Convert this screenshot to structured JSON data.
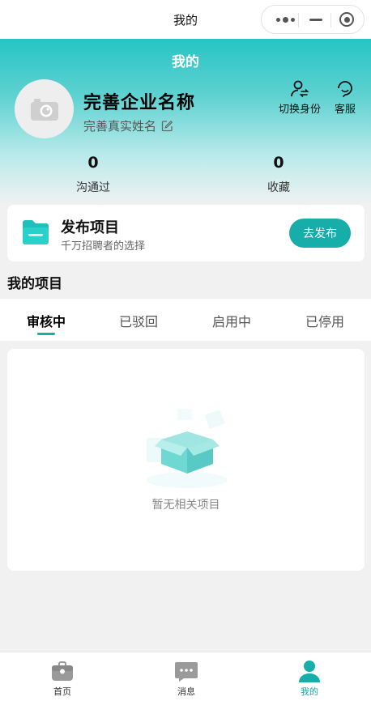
{
  "nav": {
    "title": "我的"
  },
  "header": {
    "title": "我的",
    "company_name": "完善企业名称",
    "real_name": "完善真实姓名",
    "actions": [
      {
        "label": "切换身份",
        "icon": "switch-user-icon"
      },
      {
        "label": "客服",
        "icon": "customer-service-icon"
      }
    ],
    "stats": [
      {
        "value": "0",
        "label": "沟通过"
      },
      {
        "value": "0",
        "label": "收藏"
      }
    ]
  },
  "publish": {
    "title": "发布项目",
    "subtitle": "千万招聘者的选择",
    "button": "去发布"
  },
  "projects": {
    "section_title": "我的项目",
    "tabs": [
      {
        "label": "审核中",
        "active": true
      },
      {
        "label": "已驳回",
        "active": false
      },
      {
        "label": "启用中",
        "active": false
      },
      {
        "label": "已停用",
        "active": false
      }
    ],
    "empty_text": "暂无相关项目"
  },
  "tabbar": {
    "items": [
      {
        "label": "首页",
        "icon": "home-briefcase-icon",
        "active": false
      },
      {
        "label": "消息",
        "icon": "message-icon",
        "active": false
      },
      {
        "label": "我的",
        "icon": "profile-icon",
        "active": true
      }
    ]
  },
  "colors": {
    "accent": "#17aeaa",
    "header_top": "#27c4c4",
    "inactive_icon": "#9a9a9a"
  }
}
